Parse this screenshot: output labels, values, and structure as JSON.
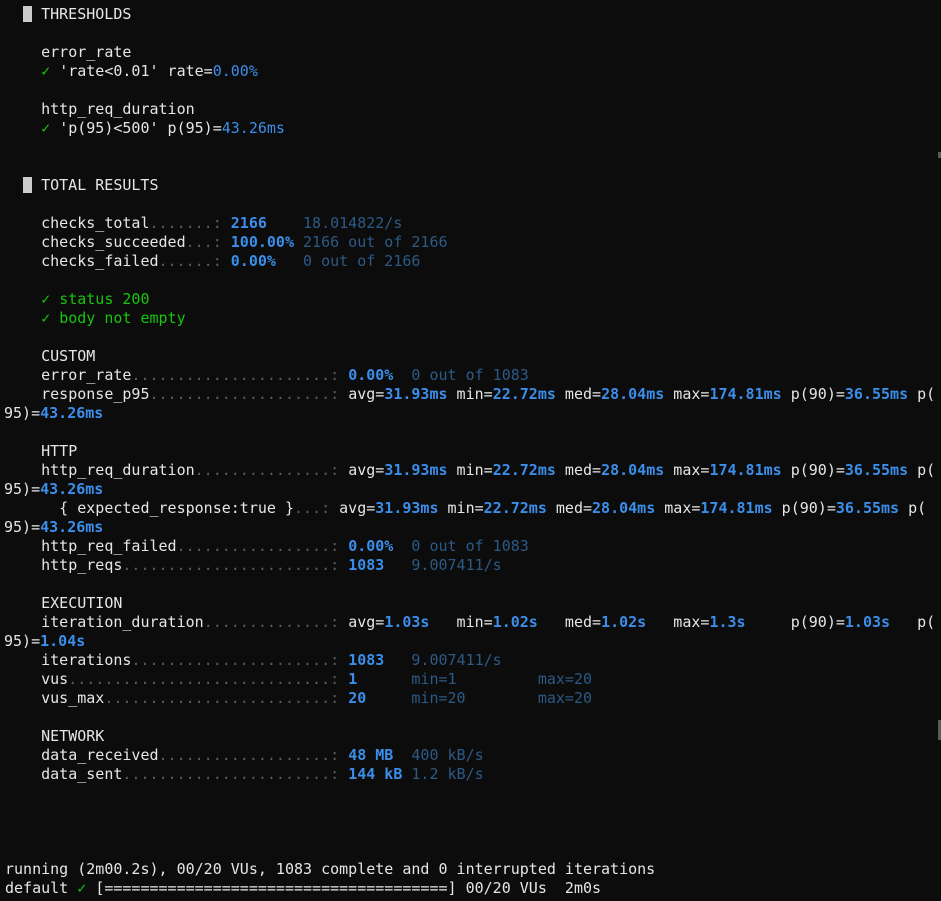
{
  "thresholds": {
    "title": "THRESHOLDS",
    "error_rate": {
      "metric": "error_rate",
      "check": "✓",
      "text": "'rate<0.01' rate=",
      "value": "0.00%"
    },
    "http_req_duration": {
      "metric": "http_req_duration",
      "check": "✓",
      "text": "'p(95)<500' p(95)=",
      "value": "43.26ms"
    }
  },
  "total": {
    "title": "TOTAL RESULTS",
    "checks": [
      {
        "label": "checks_total",
        "dots": ".......: ",
        "value": "2166",
        "pad": "    ",
        "extra": "18.014822/s"
      },
      {
        "label": "checks_succeeded",
        "dots": "...: ",
        "value": "100.00%",
        "pad": " ",
        "extra": "2166 out of 2166"
      },
      {
        "label": "checks_failed",
        "dots": "......: ",
        "value": "0.00%",
        "pad": "   ",
        "extra": "0 out of 2166"
      }
    ],
    "passed": [
      {
        "check": "✓",
        "text": "status 200"
      },
      {
        "check": "✓",
        "text": "body not empty"
      }
    ]
  },
  "custom": {
    "title": "CUSTOM",
    "error_rate": {
      "label": "error_rate",
      "dots": "......................: ",
      "value": "0.00%",
      "extra": "0 out of 1083"
    },
    "response_p95": {
      "label": "response_p95",
      "dots": "....................: "
    }
  },
  "trend": {
    "avg": "31.93ms",
    "min": "22.72ms",
    "med": "28.04ms",
    "max": "174.81ms",
    "p90": "36.55ms",
    "p95": "43.26ms"
  },
  "http": {
    "title": "HTTP",
    "duration": {
      "label": "http_req_duration",
      "dots": "...............: "
    },
    "expected": {
      "label": "  { expected_response:true }",
      "dots": "...: "
    },
    "failed": {
      "label": "http_req_failed",
      "dots": ".................: ",
      "value": "0.00%",
      "extra": "0 out of 1083"
    },
    "reqs": {
      "label": "http_reqs",
      "dots": ".......................: ",
      "value": "1083",
      "extra": "9.007411/s"
    }
  },
  "execution": {
    "title": "EXECUTION",
    "iteration_duration": {
      "label": "iteration_duration",
      "dots": "..............: ",
      "avg": "1.03s",
      "min": "1.02s",
      "med": "1.02s",
      "max": "1.3s",
      "p90": "1.03s",
      "p95": "1.04s"
    },
    "iterations": {
      "label": "iterations",
      "dots": "......................: ",
      "value": "1083",
      "extra": "9.007411/s"
    },
    "vus": {
      "label": "vus",
      "dots": ".............................: ",
      "value": "1",
      "min": "min=1",
      "max": "max=20"
    },
    "vus_max": {
      "label": "vus_max",
      "dots": ".........................: ",
      "value": "20",
      "min": "min=20",
      "max": "max=20"
    }
  },
  "network": {
    "title": "NETWORK",
    "received": {
      "label": "data_received",
      "dots": "...................: ",
      "value": "48 MB",
      "extra": "400 kB/s"
    },
    "sent": {
      "label": "data_sent",
      "dots": ".......................: ",
      "value": "144 kB",
      "extra": "1.2 kB/s"
    }
  },
  "status": {
    "running": "running (2m00.2s), 00/20 VUs, 1083 complete and 0 interrupted iterations",
    "scenario": "default",
    "check": "✓",
    "progress": "[======================================]",
    "vus": "00/20 VUs",
    "elapsed": "2m0s"
  }
}
